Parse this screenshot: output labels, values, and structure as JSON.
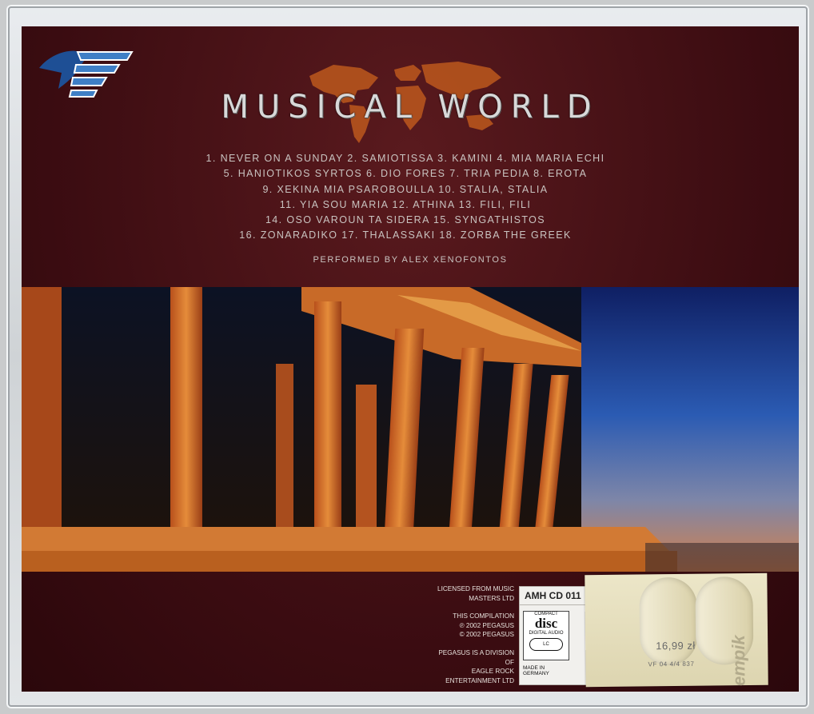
{
  "title": "MUSICAL WORLD",
  "tracks": [
    "1. NEVER ON A SUNDAY  2. SAMIOTISSA  3. KAMINI  4. MIA MARIA ECHI",
    "5. HANIOTIKOS SYRTOS  6. DIO FORES  7. TRIA PEDIA  8. EROTA",
    "9. XEKINA MIA PSAROBOULLA  10. STALIA, STALIA",
    "11. YIA SOU MARIA  12. ATHINA  13. FILI, FILI",
    "14. OSO VAROUN TA SIDERA  15. SYNGATHISTOS",
    "16. ZONARADIKO  17. THALASSAKI  18. ZORBA THE GREEK"
  ],
  "performer": "PERFORMED BY ALEX XENOFONTOS",
  "legal": {
    "line1": "LICENSED FROM MUSIC",
    "line2": "MASTERS LTD",
    "line3": "THIS COMPILATION",
    "line4": "℗ 2002 PEGASUS",
    "line5": "© 2002 PEGASUS",
    "line6": "PEGASUS IS A DIVISION OF",
    "line7": "EAGLE ROCK ENTERTAINMENT LTD"
  },
  "catalog": "AMH CD 011",
  "disc_logo": {
    "top": "COMPACT",
    "main": "disc",
    "sub": "DIGITAL AUDIO",
    "lc": "LC"
  },
  "made_in": "MADE IN GERMANY",
  "sticker": {
    "price": "16,99 zł",
    "code": "VF 04 4/4   837",
    "brand": "empik"
  },
  "colors": {
    "background": "#3d0d12",
    "title": "#d8d8d8",
    "map": "#d2691e",
    "logo": "#3f7fc6"
  },
  "icons": {
    "logo": "pegasus-logo-icon",
    "map": "world-map-icon"
  }
}
